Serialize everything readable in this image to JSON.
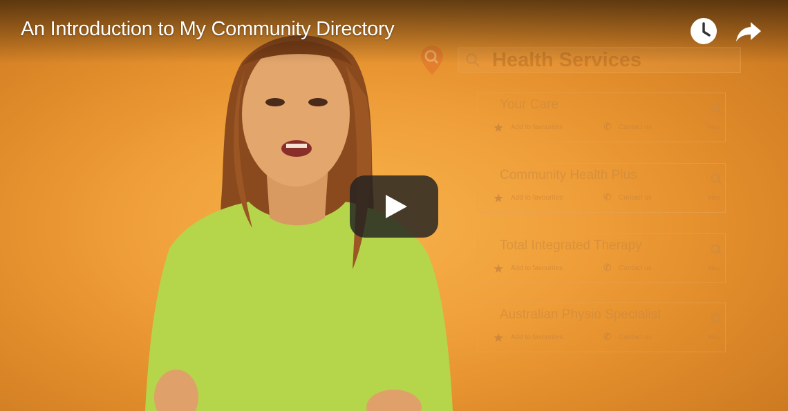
{
  "video": {
    "title": "An Introduction to My Community Directory"
  },
  "controls": {
    "watch_later_icon": "clock-icon",
    "share_icon": "share-arrow-icon",
    "play_icon": "play-icon"
  },
  "background_screen": {
    "search_text": "Health Services",
    "services": [
      {
        "name": "Your Care",
        "fav": "Add to favourites",
        "contact": "Contact us",
        "map": "Map"
      },
      {
        "name": "Community Health Plus",
        "fav": "Add to favourites",
        "contact": "Contact us",
        "map": "Map"
      },
      {
        "name": "Total Integrated Therapy",
        "fav": "Add to favourites",
        "contact": "Contact us",
        "map": "Map"
      },
      {
        "name": "Australian Physio Specialist",
        "fav": "Add to favourites",
        "contact": "Contact us",
        "map": "Map"
      }
    ]
  },
  "colors": {
    "background": "#f0a03a",
    "accent_orange": "#e9a14a",
    "shirt": "#b9d84a",
    "play_button": "#212121"
  }
}
